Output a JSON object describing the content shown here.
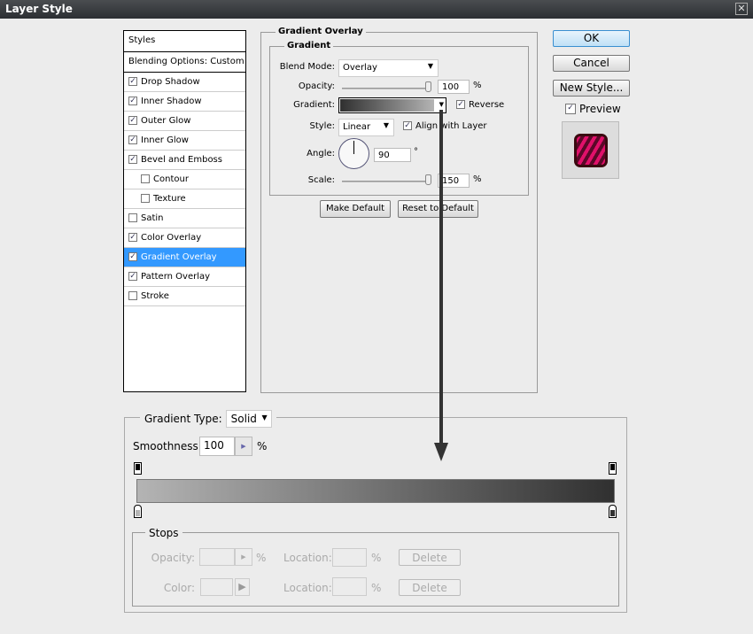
{
  "window": {
    "title": "Layer Style",
    "close": "✕"
  },
  "styles_list": {
    "header": "Styles",
    "blending": "Blending Options: Custom",
    "items": [
      {
        "label": "Drop Shadow",
        "checked": true
      },
      {
        "label": "Inner Shadow",
        "checked": true
      },
      {
        "label": "Outer Glow",
        "checked": true
      },
      {
        "label": "Inner Glow",
        "checked": true
      },
      {
        "label": "Bevel and Emboss",
        "checked": true
      },
      {
        "label": "Contour",
        "checked": false,
        "indent": true
      },
      {
        "label": "Texture",
        "checked": false,
        "indent": true
      },
      {
        "label": "Satin",
        "checked": false
      },
      {
        "label": "Color Overlay",
        "checked": true
      },
      {
        "label": "Gradient Overlay",
        "checked": true,
        "selected": true
      },
      {
        "label": "Pattern Overlay",
        "checked": true
      },
      {
        "label": "Stroke",
        "checked": false
      }
    ]
  },
  "overlay": {
    "section": "Gradient Overlay",
    "group": "Gradient",
    "blend_label": "Blend Mode:",
    "blend_value": "Overlay",
    "opacity_label": "Opacity:",
    "opacity_value": "100",
    "opacity_pct": 100,
    "percent": "%",
    "gradient_label": "Gradient:",
    "reverse_label": "Reverse",
    "reverse": true,
    "style_label": "Style:",
    "style_value": "Linear",
    "align_label": "Align with Layer",
    "align": true,
    "angle_label": "Angle:",
    "angle_value": "90",
    "degree": "°",
    "scale_label": "Scale:",
    "scale_value": "150",
    "make_default": "Make Default",
    "reset_default": "Reset to Default"
  },
  "buttons": {
    "ok": "OK",
    "cancel": "Cancel",
    "new_style": "New Style...",
    "preview": "Preview",
    "check": "✓"
  },
  "editor": {
    "type_label": "Gradient Type:",
    "type_value": "Solid",
    "smooth_label": "Smoothness:",
    "smooth_value": "100",
    "percent": "%",
    "stops": "Stops",
    "opacity_label": "Opacity:",
    "color_label": "Color:",
    "location_label": "Location:",
    "delete": "Delete",
    "colors": {
      "start": "#b4b4b4",
      "end": "#303030"
    }
  }
}
